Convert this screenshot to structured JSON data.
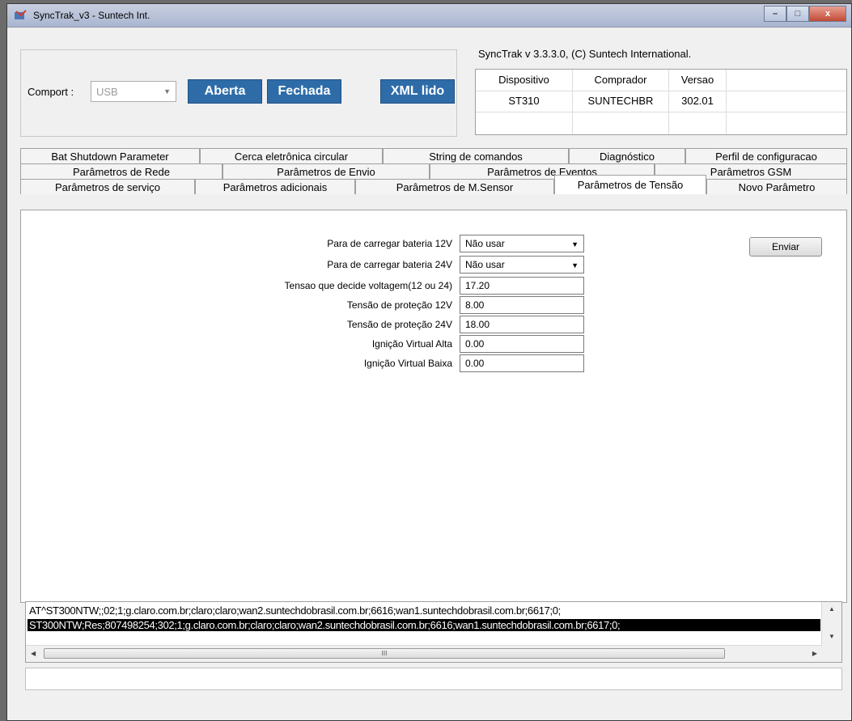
{
  "window": {
    "title": "SyncTrak_v3 - Suntech Int.",
    "controls": {
      "minimize": "–",
      "maximize": "□",
      "close": "x"
    }
  },
  "connection": {
    "comport_label": "Comport :",
    "comport_value": "USB",
    "open_button": "Aberta",
    "close_button": "Fechada",
    "xml_button": "XML lido",
    "accent_color": "#2e6ca8"
  },
  "version_text": "SyncTrak v 3.3.3.0, (C) Suntech International.",
  "device_table": {
    "headers": [
      "Dispositivo",
      "Comprador",
      "Versao"
    ],
    "rows": [
      [
        "ST310",
        "SUNTECHBR",
        "302.01"
      ]
    ]
  },
  "tabs": {
    "row1": [
      "Bat Shutdown Parameter",
      "Cerca eletrônica circular",
      "String de comandos",
      "Diagnóstico",
      "Perfil de configuracao"
    ],
    "row2": [
      "Parâmetros de Rede",
      "Parâmetros de Envio",
      "Parâmetros de Eventos",
      "Parâmetros GSM"
    ],
    "row3": [
      "Parâmetros de serviço",
      "Parâmetros adicionais",
      "Parâmetros  de M.Sensor",
      "Parâmetros de Tensão",
      "Novo Parâmetro"
    ],
    "active": "Parâmetros de Tensão"
  },
  "form": {
    "fields": [
      {
        "label": "Para de carregar bateria 12V",
        "value": "Não usar",
        "type": "select"
      },
      {
        "label": "Para de carregar bateria 24V",
        "value": "Não usar",
        "type": "select"
      },
      {
        "label": "Tensao que decide voltagem(12 ou 24)",
        "value": "17.20",
        "type": "text"
      },
      {
        "label": "Tensão de proteção 12V",
        "value": "8.00",
        "type": "text"
      },
      {
        "label": "Tensão de proteção 24V",
        "value": "18.00",
        "type": "text"
      },
      {
        "label": "Ignição Virtual Alta",
        "value": "0.00",
        "type": "text"
      },
      {
        "label": "Ignição Virtual Baixa",
        "value": "0.00",
        "type": "text"
      }
    ],
    "send_button": "Enviar"
  },
  "log": {
    "lines": [
      "AT^ST300NTW;;02;1;g.claro.com.br;claro;claro;wan2.suntechdobrasil.com.br;6616;wan1.suntechdobrasil.com.br;6617;0;",
      "ST300NTW;Res;807498254;302;1;g.claro.com.br;claro;claro;wan2.suntechdobrasil.com.br;6616;wan1.suntechdobrasil.com.br;6617;0;"
    ],
    "scroll_thumb_glyph": "III"
  },
  "status_text": ""
}
